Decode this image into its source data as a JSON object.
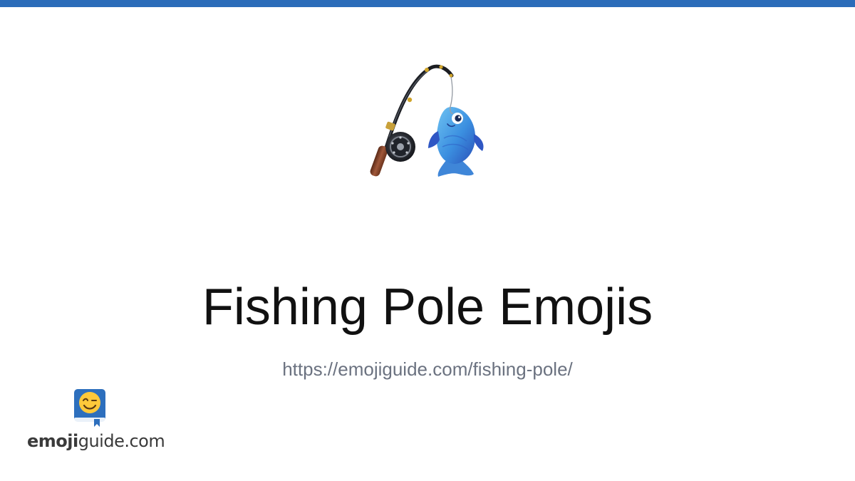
{
  "colors": {
    "top_bar": "#2b6cb9",
    "title": "#111111",
    "url": "#6b7280",
    "logo_text": "#3a3a3a",
    "book_blue": "#2d6fbd",
    "face_yellow": "#ffc93a"
  },
  "hero": {
    "icon": "fishing-pole-emoji"
  },
  "title": "Fishing Pole Emojis",
  "url": "https://emojiguide.com/fishing-pole/",
  "logo": {
    "icon": "winking-face-book-icon",
    "text_bold": "emoji",
    "text_light": "guide.com"
  }
}
